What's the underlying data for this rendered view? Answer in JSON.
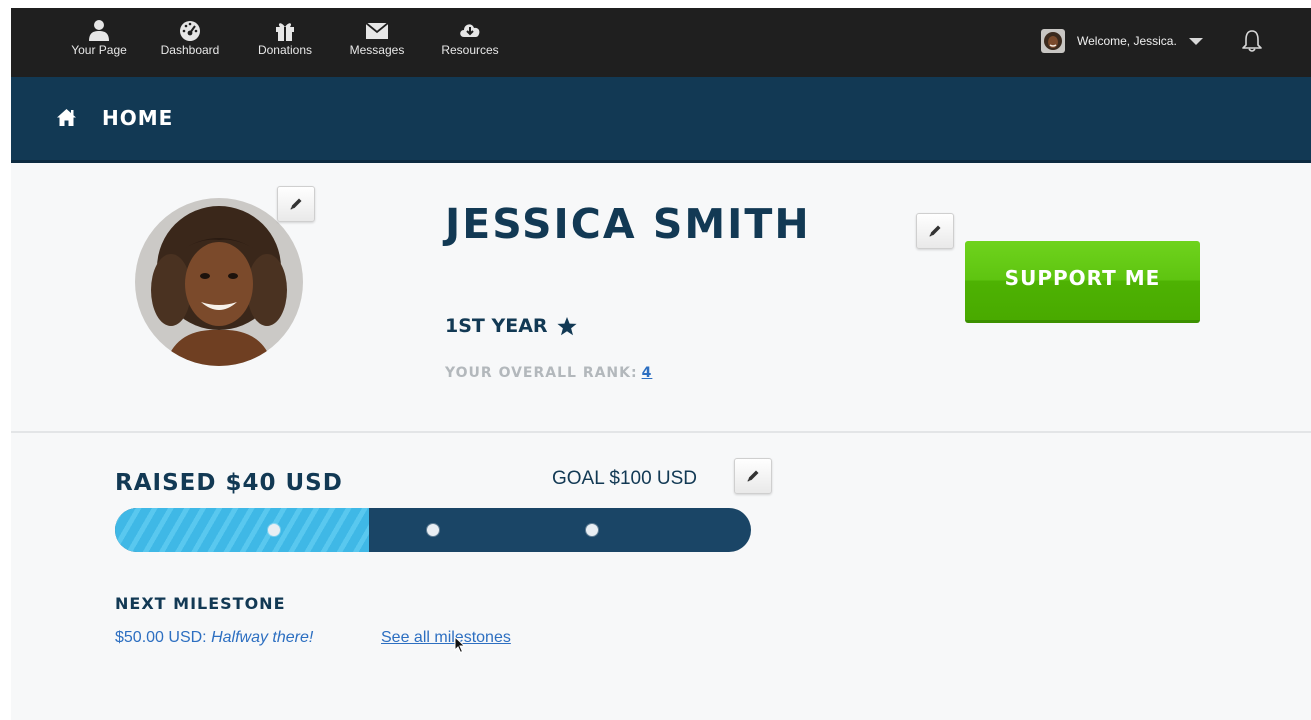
{
  "nav": {
    "items": [
      {
        "label": "Your Page",
        "icon": "user-icon"
      },
      {
        "label": "Dashboard",
        "icon": "dashboard-gauge-icon"
      },
      {
        "label": "Donations",
        "icon": "gift-icon"
      },
      {
        "label": "Messages",
        "icon": "envelope-icon"
      },
      {
        "label": "Resources",
        "icon": "cloud-download-icon"
      }
    ],
    "welcome": "Welcome, Jessica.",
    "bell_icon": "bell-icon"
  },
  "header": {
    "title": "HOME",
    "icon": "home-icon"
  },
  "profile": {
    "name": "JESSICA SMITH",
    "year": "1ST YEAR",
    "rank_label": "YOUR OVERALL RANK:",
    "rank_value": "4",
    "support_label": "SUPPORT ME"
  },
  "fundraising": {
    "raised": "RAISED $40 USD",
    "goal": "GOAL $100 USD",
    "progress_fraction": 0.4,
    "milestone_markers": [
      0.25,
      0.5,
      0.75
    ],
    "next_milestone_title": "NEXT MILESTONE",
    "next_milestone_amount": "$50.00 USD:",
    "next_milestone_desc": "Halfway there!",
    "see_all_link": "See all milestones"
  },
  "colors": {
    "topbar": "#1f1f1f",
    "header": "#123954",
    "accent_navy": "#123954",
    "progress_fill": "#3fb8e6",
    "progress_track": "#1a4566",
    "support_green": "#5ec410",
    "link_blue": "#2d6fc1"
  }
}
